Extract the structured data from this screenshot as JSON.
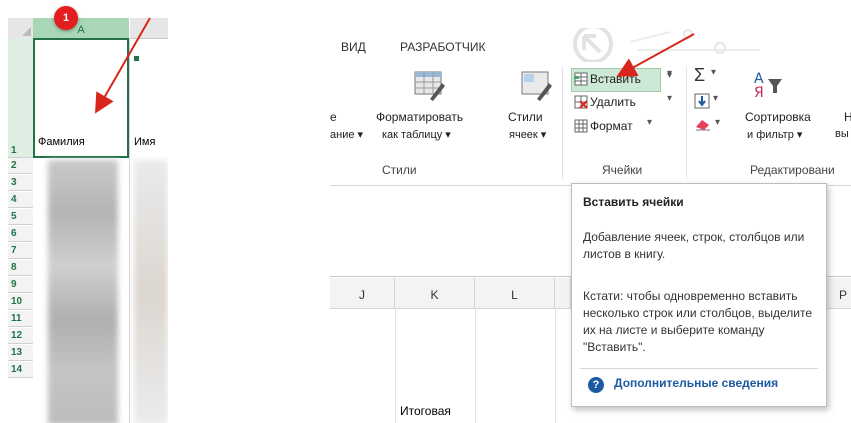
{
  "badge_number": "1",
  "left_sheet": {
    "column_a": "A",
    "row_numbers": [
      "1",
      "2",
      "3",
      "4",
      "5",
      "6",
      "7",
      "8",
      "9",
      "10",
      "11",
      "12",
      "13",
      "14"
    ],
    "header_a": "Фамилия",
    "header_b": "Имя"
  },
  "ribbon": {
    "tabs": [
      "ВИД",
      "РАЗРАБОТЧИК"
    ],
    "styles": {
      "cond_tail_1": "е",
      "cond_tail_2": "ание ▾",
      "format_table_1": "Форматировать",
      "format_table_2": "как таблицу ▾",
      "cell_styles_1": "Стили",
      "cell_styles_2": "ячеек ▾",
      "group_label": "Стили"
    },
    "cells": {
      "insert": "Вставить",
      "delete": "Удалить",
      "format": "Формат",
      "group_label": "Ячейки"
    },
    "editing": {
      "sigma": "Σ",
      "sort_1": "Сортировка",
      "sort_2": "и фильтр ▾",
      "find_1": "Н",
      "find_2": "вы",
      "group_label": "Редактировани"
    }
  },
  "right_sheet": {
    "columns": [
      "J",
      "K",
      "L",
      "P"
    ],
    "cell_text": "Итоговая"
  },
  "tooltip": {
    "title": "Вставить ячейки",
    "description": "Добавление ячеек, строк, столбцов или листов в книгу.",
    "tip": "Кстати: чтобы одновременно вставить несколько строк или столбцов, выделите их на листе и выберите команду \"Вставить\".",
    "link": "Дополнительные сведения"
  },
  "colors": {
    "excel_green": "#217346",
    "selection_green": "#cde8d4",
    "arrow_red": "#d9261c",
    "link_blue": "#1e5aa0"
  }
}
